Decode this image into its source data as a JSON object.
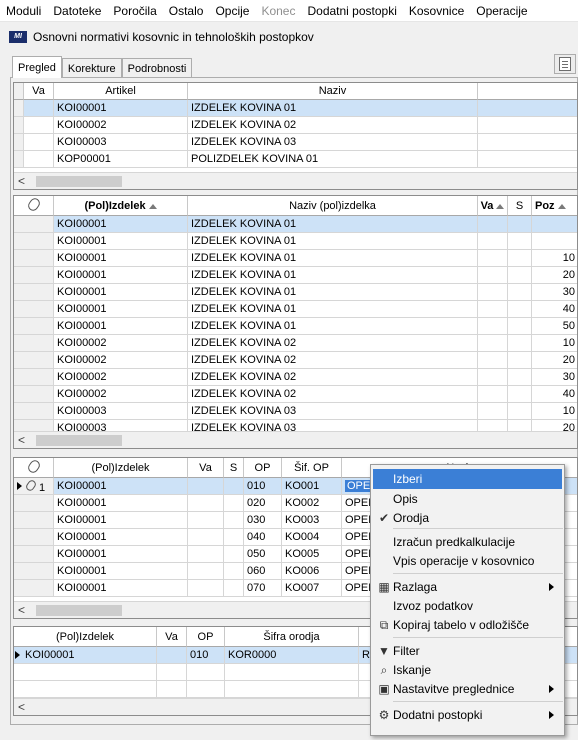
{
  "menubar": {
    "items": [
      "Moduli",
      "Datoteke",
      "Poročila",
      "Ostalo",
      "Opcije",
      "Konec",
      "Dodatni postopki",
      "Kosovnice",
      "Operacije"
    ]
  },
  "window": {
    "logo": "MI",
    "title": "Osnovni normativi kosovnic in tehnoloških postopkov"
  },
  "tabs": [
    "Pregled",
    "Korekture",
    "Podrobnosti"
  ],
  "grid1": {
    "headers": [
      "Va",
      "Artikel",
      "Naziv"
    ],
    "rows": [
      [
        "",
        "KOI00001",
        "IZDELEK KOVINA 01"
      ],
      [
        "",
        "KOI00002",
        "IZDELEK KOVINA 02"
      ],
      [
        "",
        "KOI00003",
        "IZDELEK KOVINA 03"
      ],
      [
        "",
        "KOP00001",
        "POLIZDELEK KOVINA 01"
      ]
    ]
  },
  "grid2": {
    "headers": [
      "(Pol)Izdelek",
      "Naziv (pol)izdelka",
      "Va",
      "S",
      "Poz"
    ],
    "rows": [
      [
        "KOI00001",
        "IZDELEK KOVINA 01",
        ""
      ],
      [
        "KOI00001",
        "IZDELEK KOVINA 01",
        ""
      ],
      [
        "KOI00001",
        "IZDELEK KOVINA 01",
        "10"
      ],
      [
        "KOI00001",
        "IZDELEK KOVINA 01",
        "20"
      ],
      [
        "KOI00001",
        "IZDELEK KOVINA 01",
        "30"
      ],
      [
        "KOI00001",
        "IZDELEK KOVINA 01",
        "40"
      ],
      [
        "KOI00001",
        "IZDELEK KOVINA 01",
        "50"
      ],
      [
        "KOI00002",
        "IZDELEK KOVINA 02",
        "10"
      ],
      [
        "KOI00002",
        "IZDELEK KOVINA 02",
        "20"
      ],
      [
        "KOI00002",
        "IZDELEK KOVINA 02",
        "30"
      ],
      [
        "KOI00002",
        "IZDELEK KOVINA 02",
        "40"
      ],
      [
        "KOI00003",
        "IZDELEK KOVINA 03",
        "10"
      ],
      [
        "KOI00003",
        "IZDELEK KOVINA 03",
        "20"
      ]
    ]
  },
  "grid3": {
    "headers": [
      "(Pol)Izdelek",
      "Va",
      "S",
      "OP",
      "Šif. OP",
      "Naziv"
    ],
    "first_row_num": "1",
    "rows": [
      [
        "KOI00001",
        "010",
        "KO001",
        "OPE"
      ],
      [
        "KOI00001",
        "020",
        "KO002",
        "OPEF"
      ],
      [
        "KOI00001",
        "030",
        "KO003",
        "OPEF"
      ],
      [
        "KOI00001",
        "040",
        "KO004",
        "OPEF"
      ],
      [
        "KOI00001",
        "050",
        "KO005",
        "OPEF"
      ],
      [
        "KOI00001",
        "060",
        "KO006",
        "OPEF"
      ],
      [
        "KOI00001",
        "070",
        "KO007",
        "OPEF"
      ]
    ]
  },
  "grid4": {
    "headers": [
      "(Pol)Izdelek",
      "Va",
      "OP",
      "Šifra orodja"
    ],
    "rows": [
      [
        "KOI00001",
        "010",
        "KOR0000",
        "Re"
      ]
    ]
  },
  "context_menu": {
    "items": [
      {
        "label": "Izberi",
        "icon": "",
        "submenu": false,
        "highlighted": true
      },
      {
        "label": "Opis",
        "icon": "",
        "submenu": false
      },
      {
        "label": "Orodja",
        "icon": "check-icon",
        "submenu": false
      },
      {
        "label": "Izračun predkalkulacije",
        "icon": "",
        "submenu": false
      },
      {
        "label": "Vpis operacije v kosovnico",
        "icon": "",
        "submenu": false
      },
      {
        "label": "Razlaga",
        "icon": "columns-icon",
        "submenu": true
      },
      {
        "label": "Izvoz podatkov",
        "icon": "",
        "submenu": false
      },
      {
        "label": "Kopiraj tabelo v odložišče",
        "icon": "copy-icon",
        "submenu": false
      },
      {
        "label": "Filter",
        "icon": "filter-icon",
        "submenu": false
      },
      {
        "label": "Iskanje",
        "icon": "search-icon",
        "submenu": false
      },
      {
        "label": "Nastavitve preglednice",
        "icon": "settings-icon",
        "submenu": true
      },
      {
        "label": "Dodatni postopki",
        "icon": "tools-icon",
        "submenu": true
      }
    ]
  },
  "colors": {
    "selection": "#cde2f7",
    "menu_highlight": "#3b7fd6",
    "logo_bg": "#1b2e6b"
  }
}
